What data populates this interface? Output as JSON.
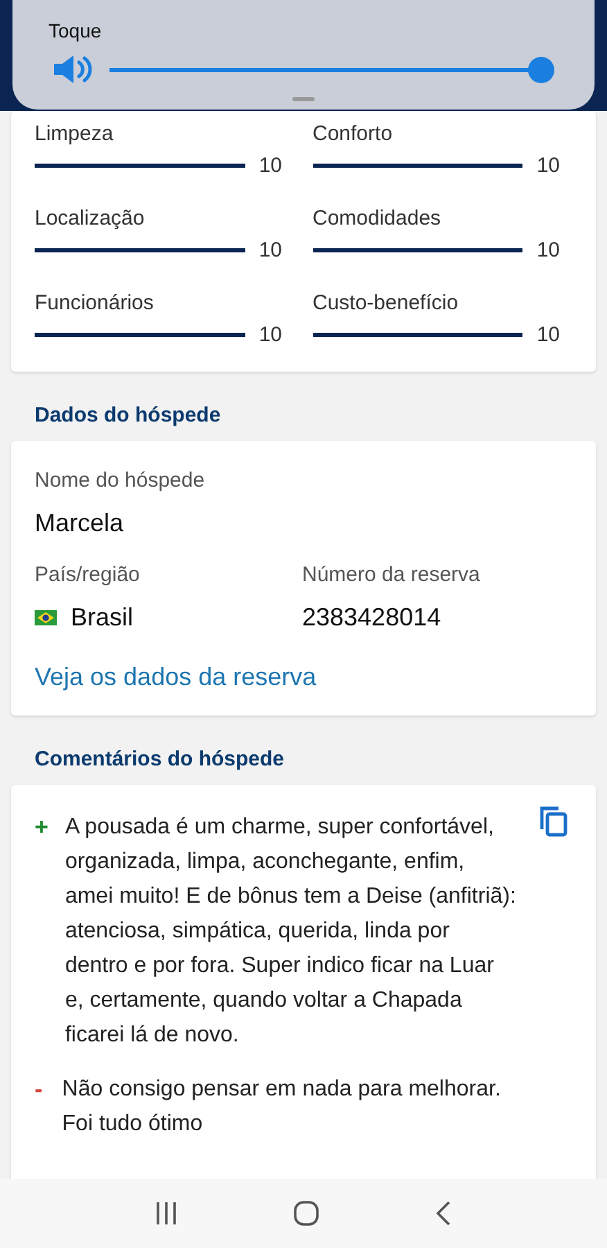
{
  "volume_panel": {
    "label": "Toque",
    "level": 1
  },
  "scores": [
    {
      "label": "Limpeza",
      "level": 1,
      "value": "10"
    },
    {
      "label": "Conforto",
      "level": 1,
      "value": "10"
    },
    {
      "label": "Localização",
      "level": 1,
      "value": "10"
    },
    {
      "label": "Comodidades",
      "level": 1,
      "value": "10"
    },
    {
      "label": "Funcionários",
      "level": 1,
      "value": "10"
    },
    {
      "label": "Custo-benefício",
      "level": 1,
      "value": "10"
    }
  ],
  "guest": {
    "heading": "Dados do hóspede",
    "name_label": "Nome do hóspede",
    "name": "Marcela",
    "country_label": "País/região",
    "country": "Brasil",
    "booking_label": "Número da reserva",
    "booking": "2383428014",
    "link": "Veja os dados da reserva"
  },
  "comments": {
    "heading": "Comentários do hóspede",
    "items": [
      {
        "kind": "positive",
        "sign": "+",
        "text": "A pousada é um charme, super confortável, organizada, limpa, aconchegante, enfim, amei muito! E de bônus tem a Deise (anfitriã): atenciosa, simpática, querida, linda por dentro e por fora. Super indico ficar na Luar e, certamente, quando voltar a Chapada ficarei lá de novo."
      },
      {
        "kind": "negative",
        "sign": "-",
        "text": "Não consigo pensar em nada para melhorar. Foi tudo ótimo"
      }
    ]
  }
}
